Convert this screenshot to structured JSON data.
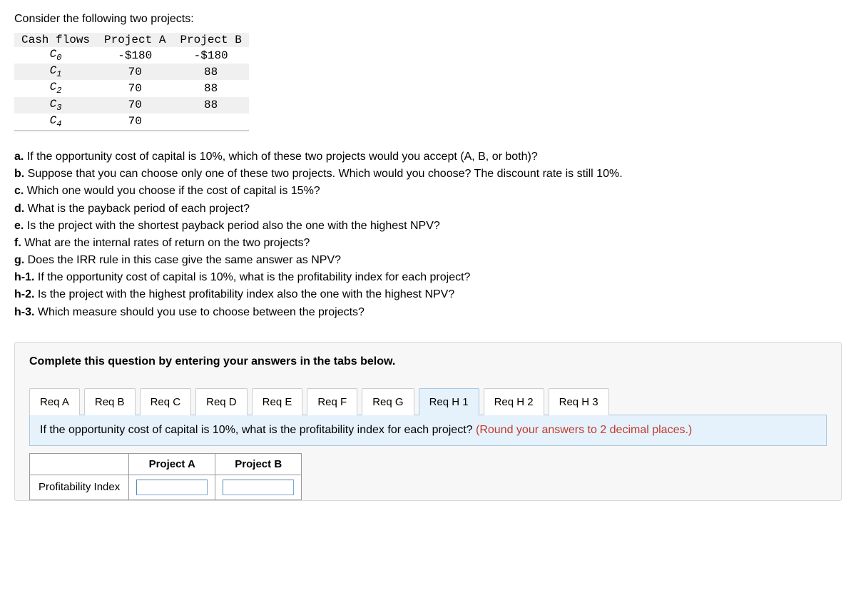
{
  "intro": "Consider the following two projects:",
  "table": {
    "headers": [
      "Cash flows",
      "Project A",
      "Project B"
    ],
    "rows": [
      {
        "label_html": "C<sub>0</sub>",
        "a": "-$180",
        "b": "-$180"
      },
      {
        "label_html": "C<sub>1</sub>",
        "a": "70",
        "b": "88"
      },
      {
        "label_html": "C<sub>2</sub>",
        "a": "70",
        "b": "88"
      },
      {
        "label_html": "C<sub>3</sub>",
        "a": "70",
        "b": "88"
      },
      {
        "label_html": "C<sub>4</sub>",
        "a": "70",
        "b": ""
      }
    ]
  },
  "questions": [
    {
      "tag": "a.",
      "text": "If the opportunity cost of capital is 10%, which of these two projects would you accept (A, B, or both)?"
    },
    {
      "tag": "b.",
      "text": "Suppose that you can choose only one of these two projects. Which would you choose? The discount rate is still 10%."
    },
    {
      "tag": "c.",
      "text": "Which one would you choose if the cost of capital is 15%?"
    },
    {
      "tag": "d.",
      "text": "What is the payback period of each project?"
    },
    {
      "tag": "e.",
      "text": "Is the project with the shortest payback period also the one with the highest NPV?"
    },
    {
      "tag": "f.",
      "text": "What are the internal rates of return on the two projects?"
    },
    {
      "tag": "g.",
      "text": "Does the IRR rule in this case give the same answer as NPV?"
    },
    {
      "tag": "h-1.",
      "text": "If the opportunity cost of capital is 10%, what is the profitability index for each project?"
    },
    {
      "tag": "h-2.",
      "text": "Is the project with the highest profitability index also the one with the highest NPV?"
    },
    {
      "tag": "h-3.",
      "text": "Which measure should you use to choose between the projects?"
    }
  ],
  "instruction": "Complete this question by entering your answers in the tabs below.",
  "tabs": [
    "Req A",
    "Req B",
    "Req C",
    "Req D",
    "Req E",
    "Req F",
    "Req G",
    "Req H 1",
    "Req H 2",
    "Req H 3"
  ],
  "active_tab_index": 7,
  "pane": {
    "prompt": "If the opportunity cost of capital is 10%, what is the profitability index for each project? ",
    "hint": "(Round your answers to 2 decimal places.)",
    "row_label": "Profitability Index",
    "col_a": "Project A",
    "col_b": "Project B",
    "val_a": "",
    "val_b": ""
  }
}
